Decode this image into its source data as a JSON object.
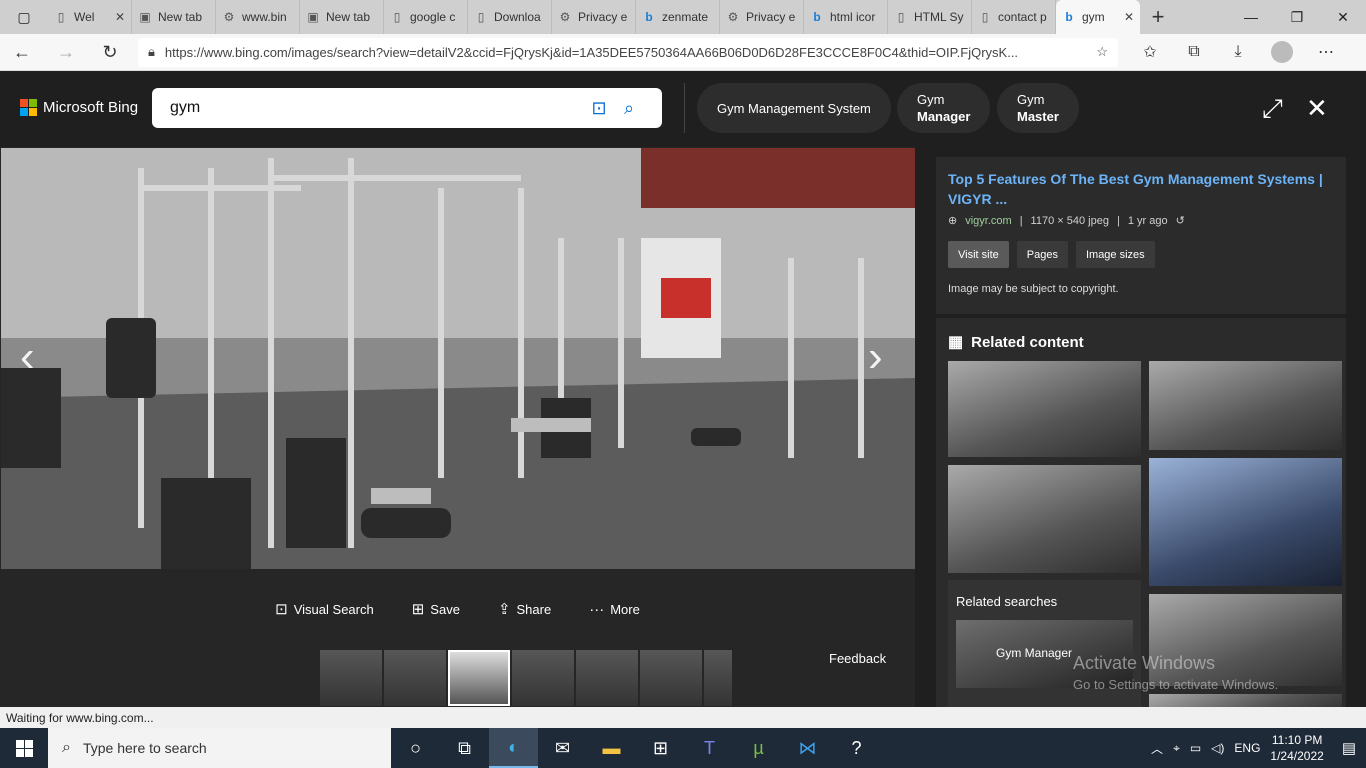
{
  "browser": {
    "tabs": [
      {
        "label": "Wel",
        "icon": "page-icon",
        "close": "✕"
      },
      {
        "label": "New tab",
        "icon": "newtab-icon",
        "close": ""
      },
      {
        "label": "www.bin",
        "icon": "gear-page-icon",
        "close": ""
      },
      {
        "label": "New tab",
        "icon": "newtab-icon",
        "close": ""
      },
      {
        "label": "google c",
        "icon": "page-icon",
        "close": ""
      },
      {
        "label": "Downloa",
        "icon": "page-icon",
        "close": ""
      },
      {
        "label": "Privacy e",
        "icon": "gear-page-icon",
        "close": ""
      },
      {
        "label": "zenmate",
        "icon": "bing-icon",
        "close": ""
      },
      {
        "label": "Privacy e",
        "icon": "gear-page-icon",
        "close": ""
      },
      {
        "label": "html icor",
        "icon": "bing-icon",
        "close": ""
      },
      {
        "label": "HTML Sy",
        "icon": "page-icon",
        "close": ""
      },
      {
        "label": "contact p",
        "icon": "page-icon",
        "close": ""
      },
      {
        "label": "gym",
        "icon": "bing-icon",
        "close": "✕"
      }
    ],
    "url": "https://www.bing.com/images/search?view=detailV2&ccid=FjQrysKj&id=1A35DEE5750364AA66B06D0D6D28FE3CCCE8F0C4&thid=OIP.FjQrysK..."
  },
  "bing": {
    "brand": "Microsoft Bing",
    "search_query": "gym",
    "chips": [
      {
        "line1": "Gym Management System",
        "line2": ""
      },
      {
        "line1": "Gym",
        "line2": "Manager"
      },
      {
        "line1": "Gym",
        "line2": "Master"
      }
    ]
  },
  "viewer": {
    "actions": [
      {
        "label": "Visual Search",
        "icon": "visual-search-icon"
      },
      {
        "label": "Save",
        "icon": "save-icon"
      },
      {
        "label": "Share",
        "icon": "share-icon"
      },
      {
        "label": "More",
        "icon": "more-icon"
      }
    ],
    "feedback": "Feedback"
  },
  "info": {
    "title": "Top 5 Features Of The Best Gym Management Systems | VIGYR ...",
    "domain": "vigyr.com",
    "size": "1170 × 540 jpeg",
    "age": "1 yr ago",
    "buttons": [
      "Visit site",
      "Pages",
      "Image sizes"
    ],
    "copyright": "Image may be subject to copyright."
  },
  "related": {
    "heading": "Related content",
    "searches_title": "Related searches",
    "search_item": "Gym Manager"
  },
  "watermark": {
    "line1": "Activate Windows",
    "line2": "Go to Settings to activate Windows."
  },
  "status": "Waiting for www.bing.com...",
  "taskbar": {
    "search_placeholder": "Type here to search",
    "lang": "ENG",
    "time": "11:10 PM",
    "date": "1/24/2022"
  }
}
